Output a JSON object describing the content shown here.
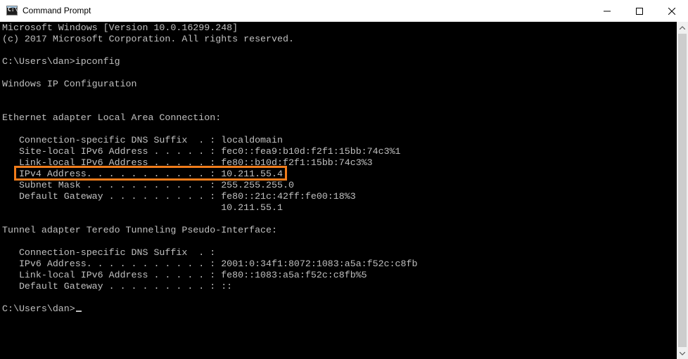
{
  "window": {
    "title": "Command Prompt",
    "app_icon": "cmd-icon",
    "app_icon_text": "C:\\"
  },
  "titlebar_buttons": [
    "minimize-icon",
    "maximize-icon",
    "close-icon"
  ],
  "console": {
    "lines": [
      "Microsoft Windows [Version 10.0.16299.248]",
      "(c) 2017 Microsoft Corporation. All rights reserved.",
      "",
      "C:\\Users\\dan>ipconfig",
      "",
      "Windows IP Configuration",
      "",
      "",
      "Ethernet adapter Local Area Connection:",
      "",
      "   Connection-specific DNS Suffix  . : localdomain",
      "   Site-local IPv6 Address . . . . . : fec0::fea9:b10d:f2f1:15bb:74c3%1",
      "   Link-local IPv6 Address . . . . . : fe80::b10d:f2f1:15bb:74c3%3",
      "   IPv4 Address. . . . . . . . . . . : 10.211.55.4",
      "   Subnet Mask . . . . . . . . . . . : 255.255.255.0",
      "   Default Gateway . . . . . . . . . : fe80::21c:42ff:fe00:18%3",
      "                                       10.211.55.1",
      "",
      "Tunnel adapter Teredo Tunneling Pseudo-Interface:",
      "",
      "   Connection-specific DNS Suffix  . :",
      "   IPv6 Address. . . . . . . . . . . : 2001:0:34f1:8072:1083:a5a:f52c:c8fb",
      "   Link-local IPv6 Address . . . . . : fe80::1083:a5a:f52c:c8fb%5",
      "   Default Gateway . . . . . . . . . : ::",
      "",
      "C:\\Users\\dan>"
    ],
    "highlighted_line": "   IPv4 Address. . . . . . . . . . . : 10.211.55.4"
  },
  "colors": {
    "console_bg": "#000000",
    "console_text": "#c0c0c0",
    "highlight": "#f07c1b",
    "titlebar_bg": "#ffffff"
  }
}
